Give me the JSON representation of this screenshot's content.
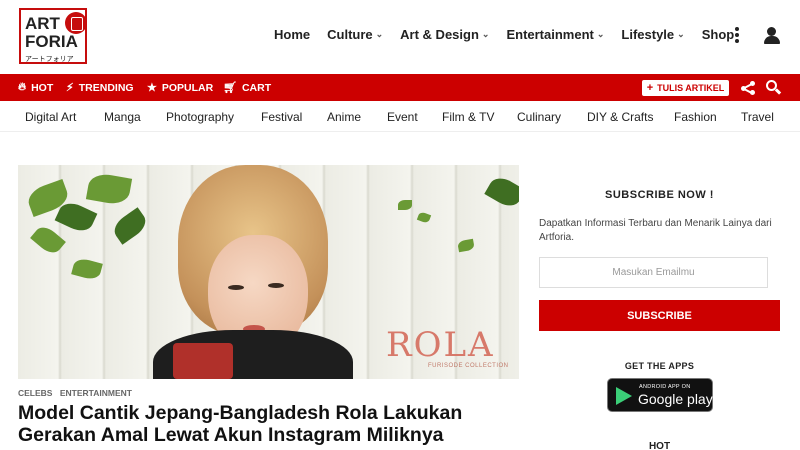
{
  "logo": {
    "line1": "ART",
    "line2": "FORIA",
    "kana": "アートフォリア"
  },
  "main_nav": [
    {
      "label": "Home",
      "has_dropdown": false
    },
    {
      "label": "Culture",
      "has_dropdown": true
    },
    {
      "label": "Art & Design",
      "has_dropdown": true
    },
    {
      "label": "Entertainment",
      "has_dropdown": true
    },
    {
      "label": "Lifestyle",
      "has_dropdown": true
    },
    {
      "label": "Shop",
      "has_dropdown": false
    }
  ],
  "redbar": {
    "links": [
      {
        "label": "HOT",
        "icon": "fire-icon"
      },
      {
        "label": "TRENDING",
        "icon": "bolt-icon"
      },
      {
        "label": "POPULAR",
        "icon": "star-icon"
      },
      {
        "label": "CART",
        "icon": "cart-icon"
      }
    ],
    "write_label": "TULIS ARTIKEL"
  },
  "categories": [
    "Digital Art",
    "Manga",
    "Photography",
    "Festival",
    "Anime",
    "Event",
    "Film & TV",
    "Culinary",
    "DIY & Crafts",
    "Fashion",
    "Travel"
  ],
  "article": {
    "image_text": "ROLA",
    "image_subtext": "FURISODE COLLECTION",
    "tags": [
      "CELEBS",
      "ENTERTAINMENT"
    ],
    "headline": "Model Cantik Jepang-Bangladesh Rola Lakukan Gerakan Amal Lewat Akun Instagram Miliknya"
  },
  "sidebar": {
    "subscribe_title": "SUBSCRIBE NOW !",
    "subscribe_desc": "Dapatkan Informasi Terbaru dan Menarik Lainya dari Artforia.",
    "email_placeholder": "Masukan Emailmu",
    "subscribe_button": "SUBSCRIBE",
    "apps_title": "GET THE APPS",
    "gplay_small": "ANDROID APP ON",
    "gplay_big": "Google play",
    "hot_title": "HOT"
  },
  "colors": {
    "brand_red": "#cc0000",
    "text": "#222222"
  }
}
